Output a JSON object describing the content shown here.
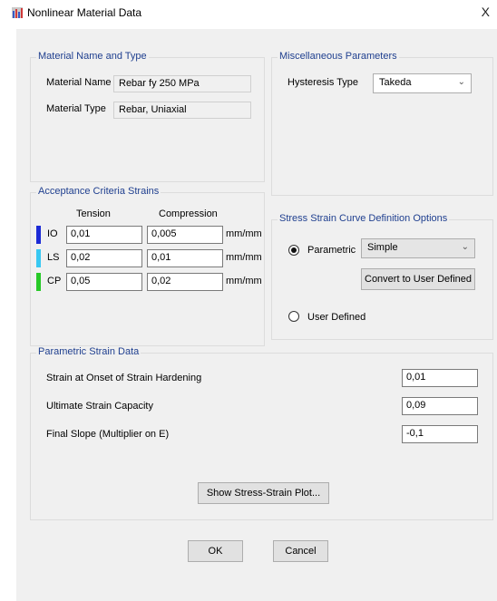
{
  "window": {
    "title": "Nonlinear Material Data",
    "close_glyph": "X"
  },
  "material": {
    "legend": "Material Name and Type",
    "name_label": "Material Name",
    "name_value": "Rebar fy 250 MPa",
    "type_label": "Material Type",
    "type_value": "Rebar, Uniaxial"
  },
  "misc": {
    "legend": "Miscellaneous Parameters",
    "hysteresis_label": "Hysteresis Type",
    "hysteresis_value": "Takeda"
  },
  "acceptance": {
    "legend": "Acceptance Criteria Strains",
    "col_tension": "Tension",
    "col_compression": "Compression",
    "rows": [
      {
        "label": "IO",
        "tension": "0,01",
        "compression": "0,005",
        "unit": "mm/mm",
        "color": "#1c2bd6"
      },
      {
        "label": "LS",
        "tension": "0,02",
        "compression": "0,01",
        "unit": "mm/mm",
        "color": "#38c8f2"
      },
      {
        "label": "CP",
        "tension": "0,05",
        "compression": "0,02",
        "unit": "mm/mm",
        "color": "#27c927"
      }
    ]
  },
  "curve": {
    "legend": "Stress Strain Curve Definition Options",
    "parametric_label": "Parametric",
    "parametric_selected": true,
    "parametric_value": "Simple",
    "convert_label": "Convert to User Defined",
    "user_defined_label": "User Defined",
    "user_defined_selected": false
  },
  "parametric": {
    "legend": "Parametric Strain Data",
    "rows": [
      {
        "label": "Strain at Onset of Strain Hardening",
        "value": "0,01"
      },
      {
        "label": "Ultimate Strain Capacity",
        "value": "0,09"
      },
      {
        "label": "Final Slope (Multiplier on E)",
        "value": "-0,1"
      }
    ],
    "plot_button": "Show Stress-Strain Plot..."
  },
  "buttons": {
    "ok": "OK",
    "cancel": "Cancel"
  },
  "icons": {
    "app": "app-icon",
    "dropdown": "chevron-down-icon"
  }
}
